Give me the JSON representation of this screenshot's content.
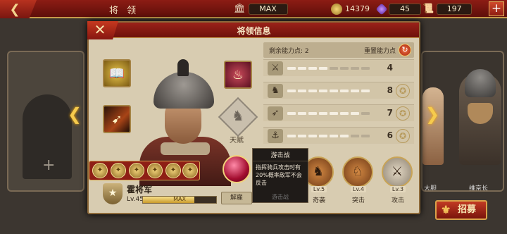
{
  "topbar": {
    "back_icon": "arrow-left",
    "title": "将 领",
    "castle_level": "MAX",
    "gold": "14379",
    "gems": "45",
    "scrolls": "197",
    "plus": "+"
  },
  "panel": {
    "title": "将领信息",
    "close": "✕"
  },
  "stats": {
    "remaining_points": "剩余能力点: 2",
    "reset_label": "重置能力点",
    "rows": [
      {
        "icon": "sword-icon",
        "glyph": "⚔",
        "filled": 4,
        "value": "4"
      },
      {
        "icon": "horse-icon",
        "glyph": "♞",
        "filled": 8,
        "value": "8"
      },
      {
        "icon": "bow-icon",
        "glyph": "➶",
        "filled": 7,
        "value": "7"
      },
      {
        "icon": "anchor-icon",
        "glyph": "⚓",
        "filled": 6,
        "value": "6"
      }
    ]
  },
  "talent": {
    "label": "天赋"
  },
  "tooltip": {
    "title": "游击战",
    "desc": "指挥骑兵攻击时有20%概率敌军不会反击",
    "name": "游击战"
  },
  "skills": [
    {
      "level": "Lv.5",
      "name": "奇袭"
    },
    {
      "level": "Lv.4",
      "name": "突击"
    },
    {
      "level": "Lv.3",
      "name": "攻击"
    }
  ],
  "general": {
    "name": "霍将军",
    "level": "Lv.45",
    "xp_text": "MAX",
    "xp_fraction": 0.7,
    "dismiss": "解雇"
  },
  "bg_cards": {
    "right_name_1": "大胆",
    "right_name_2": "维京长"
  },
  "recruit": {
    "label": "招募"
  },
  "colors": {
    "header_red": "#8c1c14",
    "panel_bg": "#d8ccb1",
    "gold_trim": "#c79a4a"
  }
}
